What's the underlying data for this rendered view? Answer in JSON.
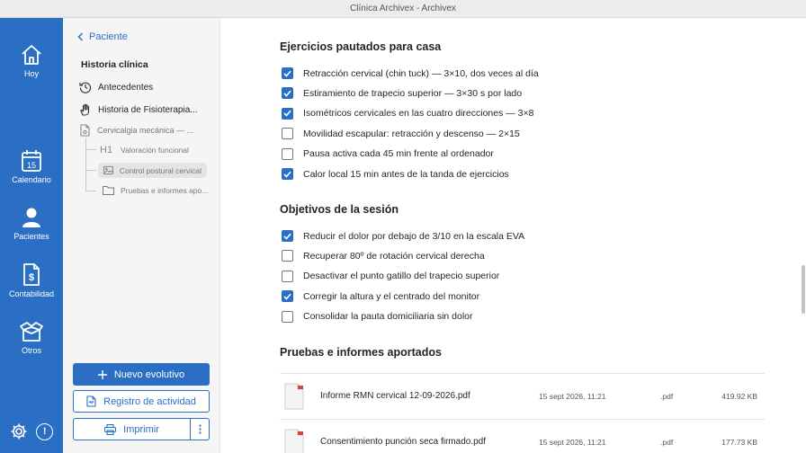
{
  "window": {
    "title": "Clínica Archivex - Archivex"
  },
  "rail": {
    "items": [
      {
        "label": "Hoy",
        "icon": "home-icon"
      },
      {
        "label": "Calendario",
        "icon": "calendar-icon",
        "day": "15"
      },
      {
        "label": "Pacientes",
        "icon": "person-icon"
      },
      {
        "label": "Contabilidad",
        "icon": "invoice-dollar-icon"
      },
      {
        "label": "Otros",
        "icon": "open-box-icon"
      }
    ],
    "bottom": {
      "settings": "gear-icon",
      "alert": "!"
    }
  },
  "sidebar": {
    "back_label": "Paciente",
    "section_title": "Historia clínica",
    "items": [
      {
        "label": "Antecedentes",
        "icon": "history-icon"
      },
      {
        "label": "Historia de Fisioterapia...",
        "icon": "hand-icon"
      },
      {
        "label": "Cervicalgia mecánica — ...",
        "icon": "document-icon"
      }
    ],
    "subitems": [
      {
        "label": "Valoración funcional",
        "icon": "heading-h1-icon",
        "glyph": "H1"
      },
      {
        "label": "Control postural cervical",
        "icon": "image-icon",
        "selected": true
      },
      {
        "label": "Pruebas e informes apo...",
        "icon": "folder-icon"
      }
    ],
    "buttons": {
      "new_note": "Nuevo evolutivo",
      "activity_log": "Registro de actividad",
      "print": "Imprimir"
    }
  },
  "main": {
    "exercises": {
      "title": "Ejercicios pautados para casa",
      "items": [
        {
          "text": "Retracción cervical (chin tuck) — 3×10, dos veces al día",
          "checked": true
        },
        {
          "text": "Estiramiento de trapecio superior — 3×30 s por lado",
          "checked": true
        },
        {
          "text": "Isométricos cervicales en las cuatro direcciones — 3×8",
          "checked": true
        },
        {
          "text": "Movilidad escapular: retracción y descenso — 2×15",
          "checked": false
        },
        {
          "text": "Pausa activa cada 45 min frente al ordenador",
          "checked": false
        },
        {
          "text": "Calor local 15 min antes de la tanda de ejercicios",
          "checked": true
        }
      ]
    },
    "objectives": {
      "title": "Objetivos de la sesión",
      "items": [
        {
          "text": "Reducir el dolor por debajo de 3/10 en la escala EVA",
          "checked": true
        },
        {
          "text": "Recuperar 80º de rotación cervical derecha",
          "checked": false
        },
        {
          "text": "Desactivar el punto gatillo del trapecio superior",
          "checked": false
        },
        {
          "text": "Corregir la altura y el centrado del monitor",
          "checked": true
        },
        {
          "text": "Consolidar la pauta domiciliaria sin dolor",
          "checked": false
        }
      ]
    },
    "files": {
      "title": "Pruebas e informes aportados",
      "rows": [
        {
          "name": "Informe RMN cervical 12-09-2026.pdf",
          "date": "15 sept 2026, 11:21",
          "ext": ".pdf",
          "size": "419.92 KB"
        },
        {
          "name": "Consentimiento punción seca firmado.pdf",
          "date": "15 sept 2026, 11:21",
          "ext": ".pdf",
          "size": "177.73 KB"
        }
      ]
    }
  },
  "colors": {
    "accent": "#2a6fc4",
    "rail_bg": "#2a6fc4",
    "sidebar_bg": "#f5f5f5"
  }
}
